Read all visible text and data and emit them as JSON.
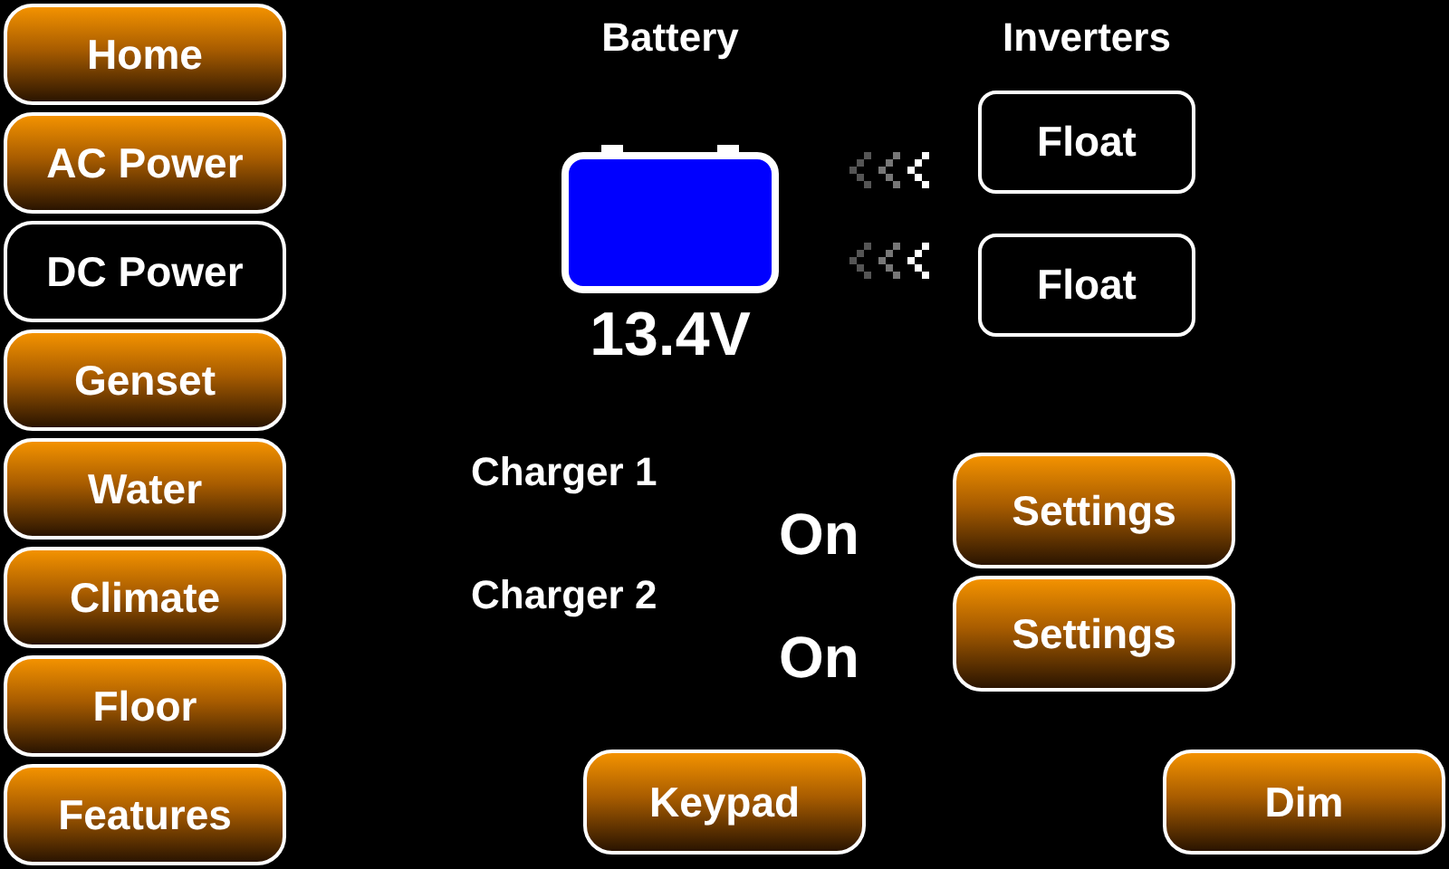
{
  "nav": [
    {
      "label": "Home",
      "selected": false
    },
    {
      "label": "AC Power",
      "selected": false
    },
    {
      "label": "DC Power",
      "selected": true
    },
    {
      "label": "Genset",
      "selected": false
    },
    {
      "label": "Water",
      "selected": false
    },
    {
      "label": "Climate",
      "selected": false
    },
    {
      "label": "Floor",
      "selected": false
    },
    {
      "label": "Features",
      "selected": false
    }
  ],
  "battery": {
    "title": "Battery",
    "voltage": "13.4V"
  },
  "inverters": {
    "title": "Inverters",
    "states": [
      "Float",
      "Float"
    ]
  },
  "chargers": [
    {
      "label": "Charger 1",
      "state": "On",
      "button": "Settings"
    },
    {
      "label": "Charger 2",
      "state": "On",
      "button": "Settings"
    }
  ],
  "bottom_buttons": [
    "Keypad",
    "Dim"
  ]
}
